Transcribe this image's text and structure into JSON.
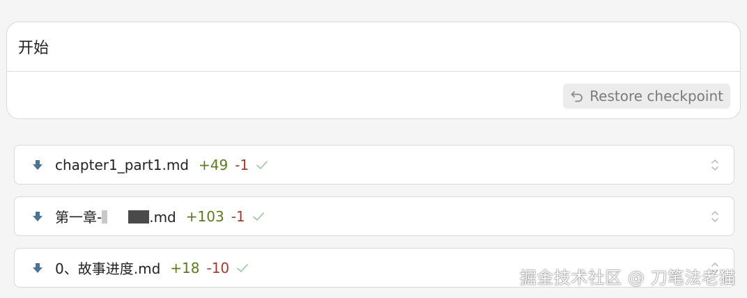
{
  "message": {
    "text": "开始",
    "restore_label": "Restore checkpoint",
    "restore_icon": "undo-arrow-icon"
  },
  "files": [
    {
      "name": "chapter1_part1.md",
      "added": "+49",
      "removed": "-1",
      "status_icon": "check-icon",
      "file_icon": "arrow-down-icon"
    },
    {
      "name_prefix": "第一章-",
      "name_suffix": ".md",
      "added": "+103",
      "removed": "-1",
      "status_icon": "check-icon",
      "file_icon": "arrow-down-icon"
    },
    {
      "name": "0、故事进度.md",
      "added": "+18",
      "removed": "-10",
      "status_icon": "check-icon",
      "file_icon": "arrow-down-icon"
    }
  ],
  "watermark": "掘金技术社区 @ 刀笔法老猫",
  "colors": {
    "added": "#5b7a1e",
    "removed": "#a43a2b",
    "check": "#9cc3a0",
    "arrow": "#4a7396"
  }
}
